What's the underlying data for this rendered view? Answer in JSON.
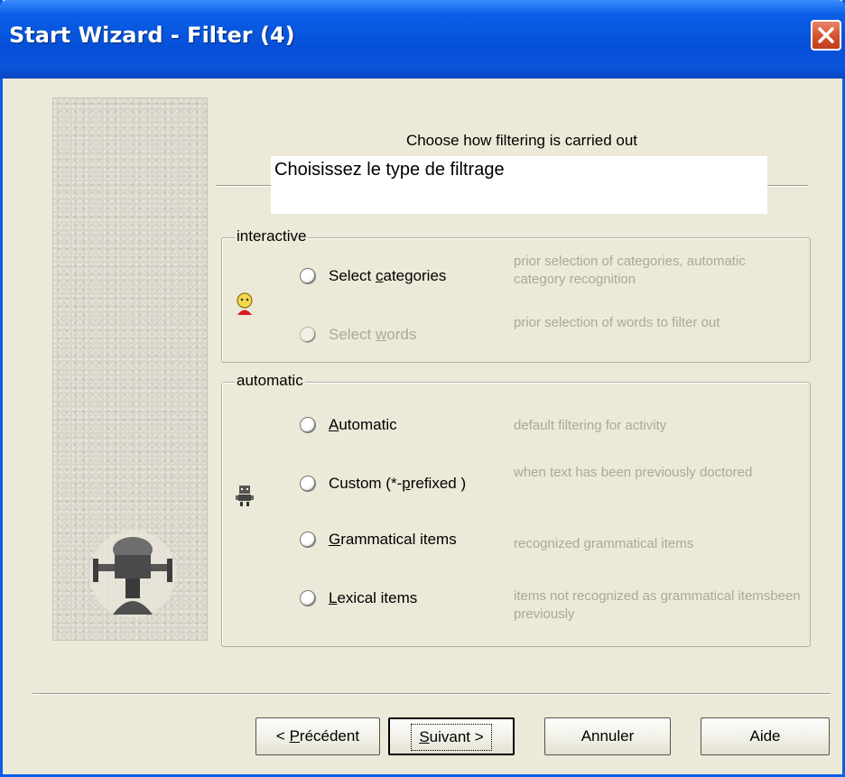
{
  "window": {
    "title": "Start Wizard - Filter (4)"
  },
  "header": {
    "instruction_en": "Choose how filtering is carried out",
    "instruction_fr": "Choisissez le type de filtrage"
  },
  "groups": {
    "interactive": {
      "legend": "interactive",
      "options": [
        {
          "pre": "Select ",
          "accel": "c",
          "post": "ategories",
          "description": "prior selection of categories, automatic category recognition",
          "enabled": true,
          "selected": false
        },
        {
          "pre": "Select ",
          "accel": "w",
          "post": "ords",
          "description": "prior selection of words to filter out",
          "enabled": false,
          "selected": false
        }
      ]
    },
    "automatic": {
      "legend": "automatic",
      "options": [
        {
          "pre": "",
          "accel": "A",
          "post": "utomatic",
          "description": "default filtering for activity",
          "enabled": true,
          "selected": false
        },
        {
          "pre": "Custom (*-",
          "accel": "p",
          "post": "refixed )",
          "description": "when text has been previously doctored",
          "enabled": true,
          "selected": false
        },
        {
          "pre": "",
          "accel": "G",
          "post": "rammatical items",
          "description": "recognized grammatical items",
          "enabled": true,
          "selected": false
        },
        {
          "pre": "",
          "accel": "L",
          "post": "exical items",
          "description": "items not recognized as grammatical itemsbeen previously",
          "enabled": true,
          "selected": false
        }
      ]
    }
  },
  "buttons": {
    "back": {
      "pre": "< ",
      "accel": "P",
      "post": "récédent"
    },
    "next": {
      "pre": "",
      "accel": "S",
      "post": "uivant >"
    },
    "cancel": "Annuler",
    "help": "Aide"
  },
  "icons": {
    "close": "close-icon",
    "interactive": "person-icon",
    "automatic": "robot-icon",
    "logo": "logo-icon"
  },
  "colors": {
    "titlebar": "#0a5fe6",
    "dialog_bg": "#ece9d8",
    "disabled_text": "#aca899",
    "close_button": "#d4502c"
  }
}
